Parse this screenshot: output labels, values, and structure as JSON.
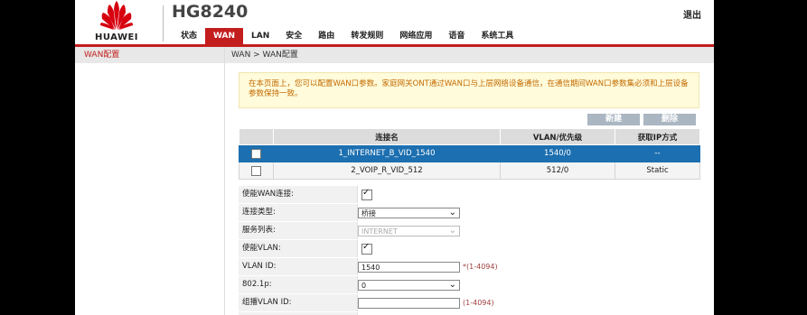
{
  "header": {
    "brand": "HUAWEI",
    "model": "HG8240",
    "logout": "退出",
    "nav": [
      "状态",
      "WAN",
      "LAN",
      "安全",
      "路由",
      "转发规则",
      "网络应用",
      "语音",
      "系统工具"
    ],
    "active_nav": "WAN"
  },
  "sidebar": {
    "items": [
      "WAN配置"
    ]
  },
  "breadcrumb": "WAN > WAN配置",
  "notice": "在本页面上，您可以配置WAN口参数。家庭网关ONT通过WAN口与上层网络设备通信，在通信期间WAN口参数集必须和上层设备参数保持一致。",
  "buttons": {
    "new": "新建",
    "delete": "删除"
  },
  "table": {
    "headers": [
      "",
      "连接名",
      "VLAN/优先级",
      "获取IP方式"
    ],
    "rows": [
      {
        "name": "1_INTERNET_B_VID_1540",
        "vlan": "1540/0",
        "ip": "--"
      },
      {
        "name": "2_VOIP_R_VID_512",
        "vlan": "512/0",
        "ip": "Static"
      }
    ]
  },
  "form": {
    "enable_wan_label": "使能WAN连接:",
    "conn_type_label": "连接类型:",
    "conn_type_value": "桥接",
    "service_label": "服务列表:",
    "service_value": "INTERNET",
    "enable_vlan_label": "使能VLAN:",
    "vlan_id_label": "VLAN ID:",
    "vlan_id_value": "1540",
    "vlan_id_hint": "*(1-4094)",
    "p8021_label": "802.1p:",
    "p8021_value": "0",
    "mcast_label": "组播VLAN ID:",
    "mcast_hint": "(1-4094)"
  },
  "colors": {
    "brand_red": "#c31d1d",
    "selected_row": "#1c6fb0"
  }
}
